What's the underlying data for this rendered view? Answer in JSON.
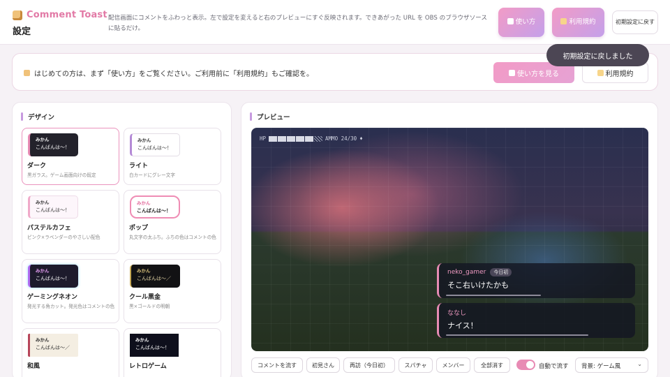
{
  "header": {
    "app_name": "Comment Toast",
    "page_title": "設定",
    "description": "配信画面にコメントをふわっと表示。左で設定を変えると右のプレビューにすぐ反映されます。できあがった URL を OBS のブラウザソースに貼るだけ。",
    "howto_label": "使い方",
    "terms_label": "利用規約",
    "reset_label": "初期設定に戻す"
  },
  "toast": {
    "text": "初期設定に戻しました"
  },
  "notice": {
    "text": "はじめての方は、まず「使い方」をご覧ください。ご利用前に「利用規約」もご確認を。",
    "howto_button": "使い方を見る",
    "terms_button": "利用規約"
  },
  "design": {
    "title": "デザイン",
    "preview_name": "みかん",
    "cards": [
      {
        "name": "ダーク",
        "desc": "黒ガラス。ゲーム画面向けの既定",
        "sample": "こんばんは〜！",
        "selected": true
      },
      {
        "name": "ライト",
        "desc": "白カードにグレー文字",
        "sample": "こんばんは〜！",
        "selected": false
      },
      {
        "name": "パステルカフェ",
        "desc": "ピンク×ラベンダーのやさしい配色",
        "sample": "こんばんは〜！",
        "selected": false
      },
      {
        "name": "ポップ",
        "desc": "丸文字の太ふち。ふちの色はコメントの色",
        "sample": "こんばんは〜！",
        "selected": false
      },
      {
        "name": "ゲーミングネオン",
        "desc": "発光する角カット。発光色はコメントの色",
        "sample": "こんばんは〜！",
        "selected": false
      },
      {
        "name": "クール黒金",
        "desc": "黒×ゴールドの明朝",
        "sample": "こんばんは〜／",
        "selected": false
      },
      {
        "name": "和風",
        "desc": "",
        "sample": "こんばんは〜／",
        "selected": false
      },
      {
        "name": "レトロゲーム",
        "desc": "",
        "sample": "こんばんは〜！",
        "selected": false
      }
    ]
  },
  "preview": {
    "title": "プレビュー",
    "hud": {
      "hp_label": "HP",
      "ammo": "AMMO 24/30"
    },
    "comments": [
      {
        "user": "neko_gamer",
        "tag": "今日初",
        "text": "そこ右いけたかも",
        "progress": 0.5
      },
      {
        "user": "ななし",
        "tag": "",
        "text": "ナイス！",
        "progress": 0.75
      }
    ],
    "controls": {
      "buttons": [
        "コメントを流す",
        "初見さん",
        "再訪（今日初）",
        "スパチャ",
        "メンバー",
        "全部消す"
      ],
      "auto_label": "自動で流す",
      "auto_on": true,
      "bg_select": "背景: ゲーム風"
    }
  },
  "colors": {
    "accent": "#e88bb4",
    "lavender": "#c4a0ea"
  }
}
